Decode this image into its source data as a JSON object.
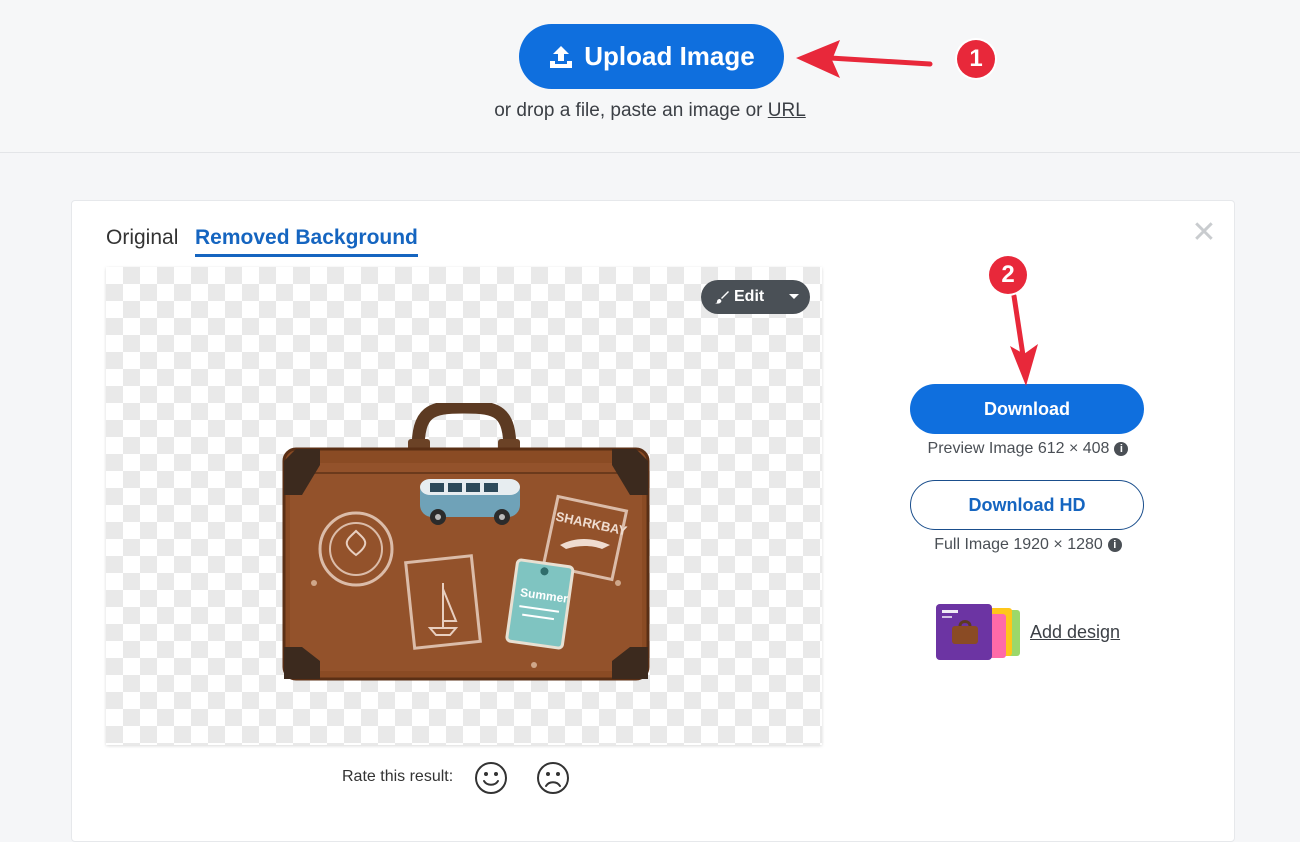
{
  "upload": {
    "button_label": "Upload Image",
    "drop_prefix": "or drop a file, paste an image or",
    "url_link": "URL"
  },
  "tabs": [
    {
      "label": "Original",
      "active": false
    },
    {
      "label": "Removed Background",
      "active": true
    }
  ],
  "preview": {
    "edit_label": "Edit",
    "image_subject": "vintage-suitcase-with-stickers",
    "sticker_texts": [
      "SHARKBAY",
      "Summer"
    ]
  },
  "rating": {
    "label": "Rate this result:"
  },
  "download": {
    "button_label": "Download",
    "preview_info": "Preview Image 612 × 408",
    "hd_button_label": "Download HD",
    "full_info": "Full Image 1920 × 1280"
  },
  "design": {
    "link_label": "Add design"
  },
  "annotations": [
    {
      "number": "1",
      "target": "upload-image-button"
    },
    {
      "number": "2",
      "target": "download-button"
    }
  ],
  "colors": {
    "primary": "#0f6fde",
    "tab_active": "#1565c0",
    "annotation_red": "#e8283a",
    "edit_button": "#4a5056"
  }
}
